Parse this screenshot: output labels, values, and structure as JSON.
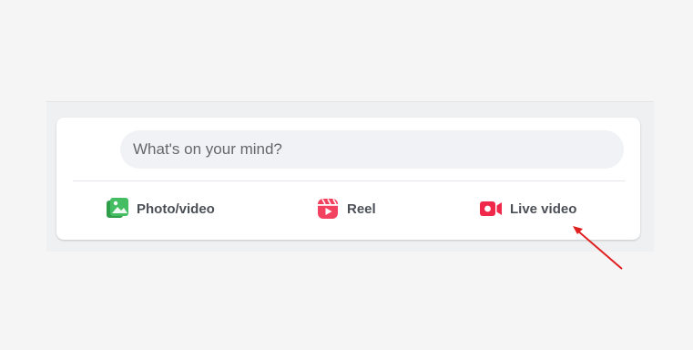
{
  "composer": {
    "placeholder": "What's on your mind?",
    "actions": [
      {
        "label": "Photo/video",
        "icon": "photo-video-icon",
        "color": "#45bd62"
      },
      {
        "label": "Reel",
        "icon": "reel-icon",
        "color": "#f3425f"
      },
      {
        "label": "Live video",
        "icon": "live-video-icon",
        "color": "#f02849"
      }
    ]
  },
  "annotation": {
    "arrow_color": "#e02020",
    "points_to": "Live video"
  }
}
